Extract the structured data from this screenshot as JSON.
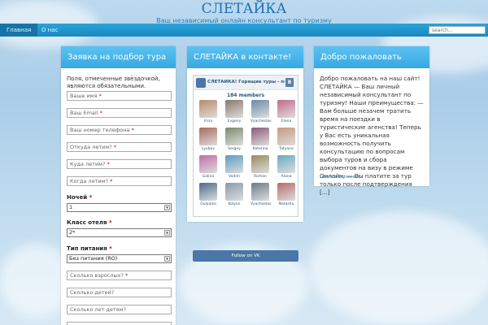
{
  "header": {
    "title": "СЛЕТАЙКА",
    "tagline": "Ваш независимый онлайн консультант по туризму"
  },
  "nav": {
    "items": [
      "Главная",
      "О нас"
    ],
    "search_placeholder": "search..."
  },
  "form_panel": {
    "title": "Заявка на подбор тура",
    "note": "Поля, отмеченные звёздочкой, являются обязательными.",
    "fields": {
      "name": "Ваше имя",
      "email": "Ваш Email",
      "phone": "Ваш номер телефона",
      "from": "Откуда летим?",
      "to": "Куда летим?",
      "when": "Когда летим?",
      "adults": "Сколько взрослых?",
      "children": "Сколько детей?",
      "children_age": "Сколько лет детям?"
    },
    "star": "*",
    "nights_label": "Ночей",
    "nights_value": "1",
    "hotel_label": "Класс отеля",
    "hotel_value": "2*",
    "food_label": "Тип питания",
    "food_value": "Без питания (RO)"
  },
  "vk_panel": {
    "title": "СЛЕТАЙКА в контакте!",
    "widget_title": "СЛЕТАЙКА! Горящие туры - подб...",
    "badge": "В",
    "members": "184 members",
    "people": [
      {
        "name": "Irina",
        "color": "#b88a6a"
      },
      {
        "name": "Evgeny",
        "color": "#8a7968"
      },
      {
        "name": "Vyacheslav",
        "color": "#6a8aa8"
      },
      {
        "name": "Elena",
        "color": "#c46a8a"
      },
      {
        "name": "Lyubov",
        "color": "#a86a5a"
      },
      {
        "name": "Sergey",
        "color": "#7a8a6a"
      },
      {
        "name": "Katerina",
        "color": "#8a5a7a"
      },
      {
        "name": "Tatyana",
        "color": "#c49a7a"
      },
      {
        "name": "Galina",
        "color": "#c46aa8"
      },
      {
        "name": "Vadim",
        "color": "#5a9ac4"
      },
      {
        "name": "Roman",
        "color": "#9a8a5a"
      },
      {
        "name": "Alona",
        "color": "#6aaac4"
      },
      {
        "name": "Gulyaika",
        "color": "#4a6a8a"
      },
      {
        "name": "Kolyan",
        "color": "#8a9aaa"
      },
      {
        "name": "Vyacheslav",
        "color": "#6a7a8a"
      },
      {
        "name": "Natasha",
        "color": "#b86a6a"
      }
    ],
    "follow": "Follow on VK"
  },
  "welcome_panel": {
    "title": "Добро пожаловать",
    "text": "Добро пожаловать на наш сайт! СЛЕТАЙКА — Ваш личный независимый консультант по туризму! Наши преимущества:  — Вам больше незачем тратить время на поездки в туристические агенства! Теперь у Вас есть уникальная возможность получить консультацию по вопросам выбора туров и сбора документов на визу в режиме Онлайн; — Вы платите за тур только после подтверждения [...]",
    "link": "Leave a comment"
  }
}
